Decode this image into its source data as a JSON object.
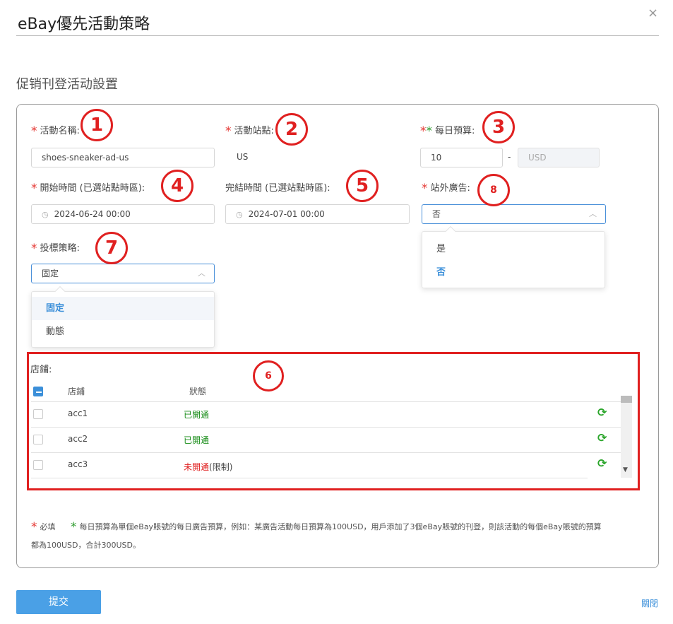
{
  "header": {
    "title": "eBay優先活動策略",
    "close_glyph": "×"
  },
  "section_title": "促销刊登活动設置",
  "fields": {
    "name": {
      "required_mark": "*",
      "label": "活動名稱:",
      "value": "shoes-sneaker-ad-us"
    },
    "site": {
      "required_mark": "*",
      "label": "活動站點:",
      "value": "US"
    },
    "budget": {
      "required_mark": "*",
      "green_mark": "*",
      "label": "每日預算:",
      "value": "10",
      "separator": "-",
      "currency_placeholder": "USD"
    },
    "start_time": {
      "required_mark": "*",
      "label": "開始時間 (已選站點時區):",
      "value": "2024-06-24 00:00"
    },
    "end_time": {
      "label": "完結時間 (已選站點時區):",
      "value": "2024-07-01 00:00"
    },
    "offsite_ads": {
      "required_mark": "*",
      "label": "站外廣告:",
      "value": "否",
      "options": [
        "是",
        "否"
      ]
    },
    "bid_strategy": {
      "required_mark": "*",
      "label": "投標策略:",
      "value": "固定",
      "options": [
        "固定",
        "動態"
      ]
    }
  },
  "annotations": [
    "1",
    "2",
    "3",
    "4",
    "5",
    "6",
    "7",
    "8"
  ],
  "store_table": {
    "label": "店鋪:",
    "headers": [
      "店鋪",
      "狀態"
    ],
    "rows": [
      {
        "store": "acc1",
        "status": "已開通",
        "status_extra": ""
      },
      {
        "store": "acc2",
        "status": "已開通",
        "status_extra": ""
      },
      {
        "store": "acc3",
        "status": "未開通",
        "status_extra": "(限制)"
      }
    ]
  },
  "footnote": {
    "required_mark": "*",
    "required_text": "必填",
    "green_mark": "*",
    "line1": "每日預算為單個eBay賬號的每日廣告預算，例如：某廣告活動每日預算為100USD，用戶添加了3個eBay賬號的刊登，則該活動的每個eBay賬號的預算",
    "line2": "都為100USD，合計300USD。"
  },
  "actions": {
    "submit_label": "提交",
    "close_label": "關閉"
  },
  "colors": {
    "accent": "#3b8fd9",
    "required": "#e53935",
    "annotation": "#e02020",
    "success": "#178c17",
    "refresh": "#2aa52a"
  },
  "icons": {
    "close": "close-icon",
    "clock": "clock-icon",
    "chevron": "chevron-up-icon",
    "refresh": "refresh-icon"
  }
}
